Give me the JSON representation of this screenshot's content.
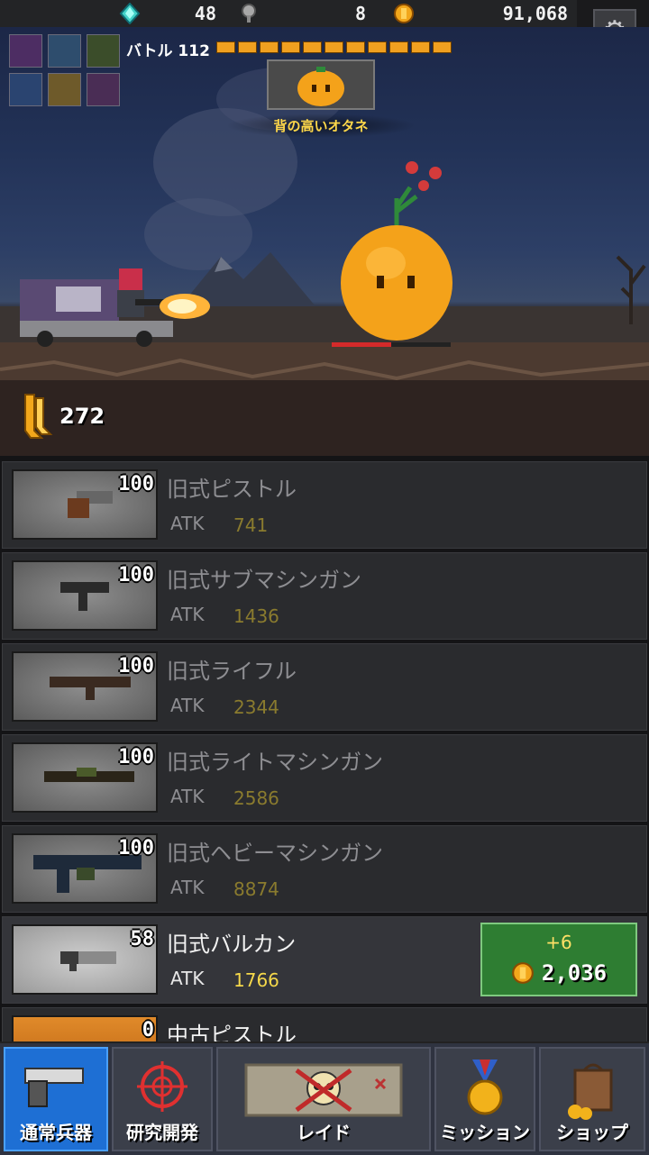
{
  "top_bar": {
    "gems": "48",
    "keys": "8",
    "coins": "91,068",
    "settings_icon": "gear-icon"
  },
  "battle": {
    "label": "バトル 112",
    "progress_segments": 11,
    "progress_filled": 11,
    "boss_name": "背の高いオタネ",
    "ammo": "272"
  },
  "weapons": [
    {
      "level": "100",
      "name": "旧式ピストル",
      "atk_label": "ATK",
      "atk": "741"
    },
    {
      "level": "100",
      "name": "旧式サブマシンガン",
      "atk_label": "ATK",
      "atk": "1436"
    },
    {
      "level": "100",
      "name": "旧式ライフル",
      "atk_label": "ATK",
      "atk": "2344"
    },
    {
      "level": "100",
      "name": "旧式ライトマシンガン",
      "atk_label": "ATK",
      "atk": "2586"
    },
    {
      "level": "100",
      "name": "旧式ヘビーマシンガン",
      "atk_label": "ATK",
      "atk": "8874"
    },
    {
      "level": "58",
      "name": "旧式バルカン",
      "atk_label": "ATK",
      "atk": "1766",
      "upgrade_plus": "+6",
      "upgrade_cost": "2,036"
    },
    {
      "level": "0",
      "name": "中古ピストル"
    }
  ],
  "nav": [
    {
      "label": "通常兵器",
      "icon": "pistol-icon",
      "active": true
    },
    {
      "label": "研究開発",
      "icon": "crosshair-icon",
      "active": false
    },
    {
      "label": "レイド",
      "icon": "skull-map-icon",
      "active": false
    },
    {
      "label": "ミッション",
      "icon": "medal-icon",
      "active": false
    },
    {
      "label": "ショップ",
      "icon": "shopping-bag-icon",
      "active": false
    }
  ],
  "colors": {
    "accent_gold": "#f5d84a",
    "nav_active": "#1e6fd4",
    "upgrade_green": "#2e7d32"
  }
}
